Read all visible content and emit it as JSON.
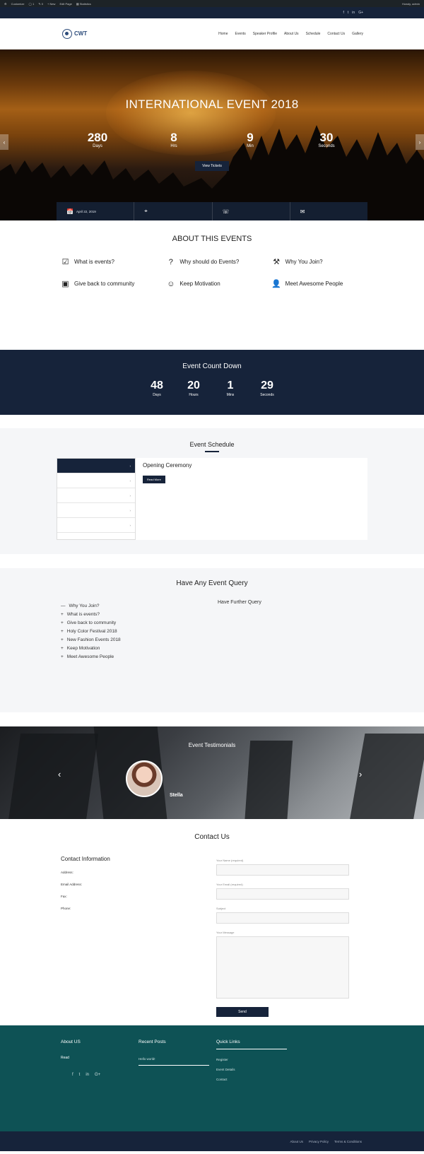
{
  "wpbar": {
    "left": [
      "⚙ ",
      "Customize",
      "◯ 1",
      "✎ 0",
      "+ New",
      "Edit Page",
      "▦ Statistics"
    ],
    "right": "Howdy, admin"
  },
  "topbar": {
    "left": "",
    "social": [
      "f",
      "t",
      "in",
      "G+"
    ]
  },
  "header": {
    "logo_title": "CWT",
    "logo_sub": "",
    "nav": [
      "Home",
      "Events",
      "Speaker Profile",
      "About Us",
      "Schedule",
      "Contact Us",
      "Gallery"
    ]
  },
  "hero": {
    "title": "INTERNATIONAL EVENT 2018",
    "subtitle": "",
    "counts": [
      {
        "n": "280",
        "u": "Days"
      },
      {
        "n": "8",
        "u": "Hrs"
      },
      {
        "n": "9",
        "u": "Min"
      },
      {
        "n": "30",
        "u": "Seconds"
      }
    ],
    "button": "View Tickets",
    "info": [
      {
        "icon": "📅",
        "label": "",
        "value": "April 22, 2019"
      },
      {
        "icon": "⌖",
        "label": "",
        "value": ""
      },
      {
        "icon": "☏",
        "label": "",
        "value": ""
      },
      {
        "icon": "✉",
        "label": "",
        "value": ""
      }
    ]
  },
  "about": {
    "title": "ABOUT THIS EVENTS",
    "features": [
      {
        "icon": "☑",
        "title": "What is events?",
        "text": ""
      },
      {
        "icon": "?",
        "title": "Why should do Events?",
        "text": ""
      },
      {
        "icon": "⚒",
        "title": "Why You Join?",
        "text": ""
      },
      {
        "icon": "▣",
        "title": "Give back to community",
        "text": ""
      },
      {
        "icon": "☺",
        "title": "Keep Motivation",
        "text": ""
      },
      {
        "icon": "👤",
        "title": "Meet Awesome People",
        "text": ""
      }
    ]
  },
  "countdown": {
    "title": "Event Count Down",
    "items": [
      {
        "n": "48",
        "u": "Days"
      },
      {
        "n": "20",
        "u": "Hours"
      },
      {
        "n": "1",
        "u": "Mins"
      },
      {
        "n": "29",
        "u": "Seconds"
      }
    ]
  },
  "schedule": {
    "title": "Event Schedule",
    "tabs": [
      "",
      "",
      "",
      "",
      ""
    ],
    "body_title": "Opening Ceremony",
    "body_text": "",
    "list": [
      "",
      ""
    ],
    "read_more": "Read More"
  },
  "query": {
    "title": "Have Any Event Query",
    "faq_open": {
      "q": "Why You Join?",
      "a": ""
    },
    "faq": [
      "What is events?",
      "Give back to community",
      "Holy Color Festival 2018",
      "New Fashion Events 2018",
      "Keep Motivation",
      "Meet Awesome People"
    ],
    "further": {
      "title": "Have Further Query",
      "text": "",
      "small": ""
    }
  },
  "testimonials": {
    "title": "Event Testimonials",
    "quote": "",
    "name": "Stella"
  },
  "contact": {
    "title": "Contact Us",
    "info_title": "Contact Information",
    "info_text": "",
    "blocks": [
      {
        "label": "Address:",
        "lines": [
          "",
          ""
        ]
      },
      {
        "label": "Email Address:",
        "lines": [
          ""
        ]
      },
      {
        "label": "Fax:",
        "lines": [
          ""
        ]
      },
      {
        "label": "Phone:",
        "lines": [
          ""
        ]
      }
    ],
    "form": {
      "labels": [
        "Your Name (required)",
        "Your Email (required)",
        "Subject",
        "Your Message"
      ],
      "send": "Send"
    }
  },
  "footer": {
    "about_title": "About US",
    "about_text": "",
    "about_more": "Read",
    "recent_title": "Recent Posts",
    "recent": [
      "Hello world!",
      "",
      "",
      "",
      ""
    ],
    "quick_title": "Quick Links",
    "quick": [
      "Register",
      "Event Details",
      "",
      "Contact",
      ""
    ],
    "social": [
      "f",
      "t",
      "in",
      "G+"
    ]
  },
  "bottombar": {
    "copy": "",
    "links": [
      "About Us",
      "Privacy Policy",
      "Terms & Conditions"
    ]
  }
}
